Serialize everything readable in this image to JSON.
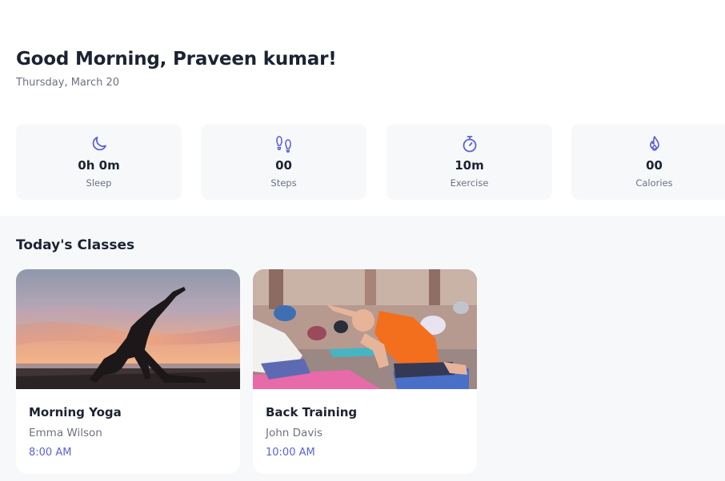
{
  "header": {
    "greeting": "Good Morning, Praveen kumar!",
    "date": "Thursday, March 20"
  },
  "stats": [
    {
      "icon": "moon-icon",
      "value": "0h 0m",
      "label": "Sleep"
    },
    {
      "icon": "footsteps-icon",
      "value": "00",
      "label": "Steps"
    },
    {
      "icon": "stopwatch-icon",
      "value": "10m",
      "label": "Exercise"
    },
    {
      "icon": "flame-icon",
      "value": "00",
      "label": "Calories"
    }
  ],
  "classes": {
    "title": "Today's Classes",
    "items": [
      {
        "name": "Morning Yoga",
        "instructor": "Emma Wilson",
        "time": "8:00 AM"
      },
      {
        "name": "Back Training",
        "instructor": "John Davis",
        "time": "10:00 AM"
      }
    ]
  },
  "colors": {
    "accent": "#5a63d8",
    "text": "#1b2333",
    "muted": "#6b7280",
    "card_bg": "#f7f8fa"
  }
}
